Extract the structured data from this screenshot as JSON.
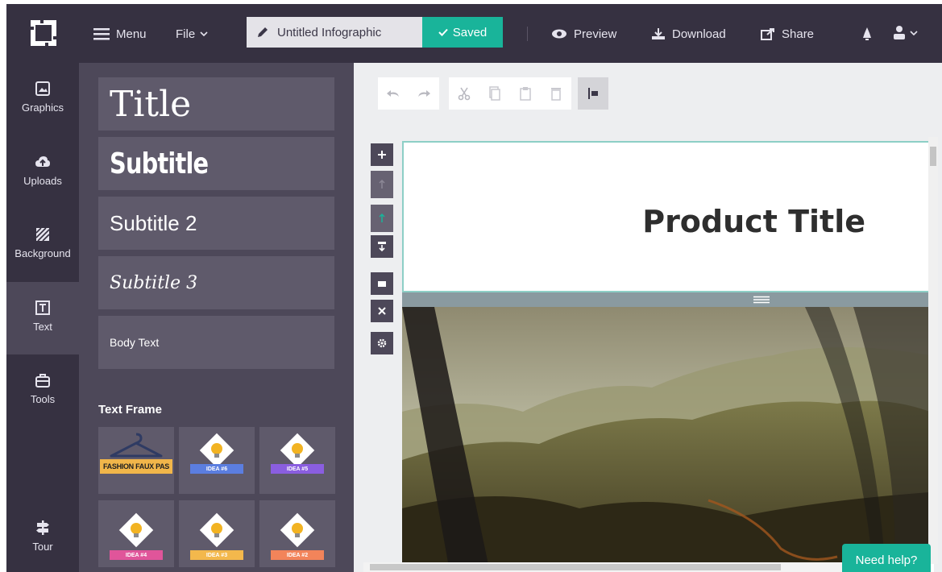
{
  "header": {
    "menu_label": "Menu",
    "file_label": "File",
    "document_title": "Untitled Infographic",
    "saved_label": "Saved",
    "preview_label": "Preview",
    "download_label": "Download",
    "share_label": "Share"
  },
  "sidebar": {
    "items": [
      {
        "label": "Graphics",
        "icon": "image-icon"
      },
      {
        "label": "Uploads",
        "icon": "cloud-upload-icon"
      },
      {
        "label": "Background",
        "icon": "background-pattern-icon"
      },
      {
        "label": "Text",
        "icon": "text-icon"
      },
      {
        "label": "Tools",
        "icon": "briefcase-icon"
      },
      {
        "label": "Tour",
        "icon": "signpost-icon"
      }
    ],
    "active": "Text"
  },
  "text_panel": {
    "styles": [
      {
        "label": "Title"
      },
      {
        "label": "Subtitle"
      },
      {
        "label": "Subtitle 2"
      },
      {
        "label": "Subtitle 3"
      },
      {
        "label": "Body Text"
      }
    ],
    "frames_heading": "Text Frame",
    "frames": [
      {
        "label": "FASHION FAUX PAS"
      },
      {
        "label": "IDEA #6"
      },
      {
        "label": "IDEA #5"
      },
      {
        "label": "IDEA #4"
      },
      {
        "label": "IDEA #3"
      },
      {
        "label": "IDEA #2"
      }
    ]
  },
  "canvas": {
    "header_title": "Product Title"
  },
  "help": {
    "label": "Need help?"
  },
  "colors": {
    "dark": "#363141",
    "panel": "#4d4859",
    "card": "#5f5a6b",
    "accent": "#19b49a"
  }
}
